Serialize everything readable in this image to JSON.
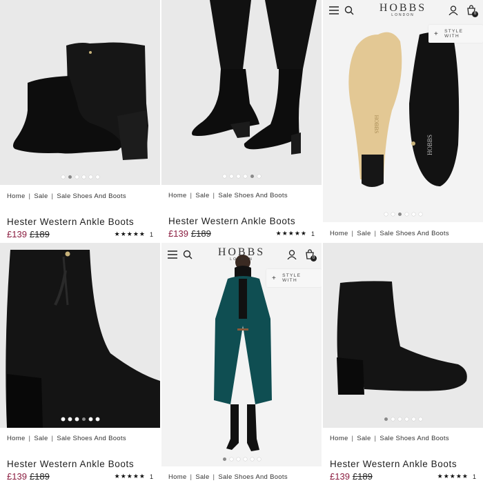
{
  "breadcrumb": {
    "home": "Home",
    "sale": "Sale",
    "category": "Sale Shoes And Boots"
  },
  "product": {
    "name": "Hester Western Ankle Boots",
    "price_now": "£139",
    "price_was": "£189",
    "stars": "★★★★★",
    "review_count": "1"
  },
  "brand": {
    "logo": "HOBBS",
    "sub": "LONDON",
    "sole_stamp": "HOBBS",
    "sole_sub": "LONDON"
  },
  "style_with": "STYLE WITH",
  "cart_count": "0",
  "carousels": {
    "t1": {
      "count": 6,
      "active": 1
    },
    "t2": {
      "count": 6,
      "active": 4
    },
    "t3": {
      "count": 6,
      "active": 2
    },
    "t4": {
      "count": 6,
      "active": 3
    },
    "t5": {
      "count": 6,
      "active": 0
    },
    "t6": {
      "count": 6,
      "active": 0
    }
  },
  "colors": {
    "price_now": "#8a1c3f",
    "coat": "#0f4e52",
    "suede": "#141414"
  }
}
